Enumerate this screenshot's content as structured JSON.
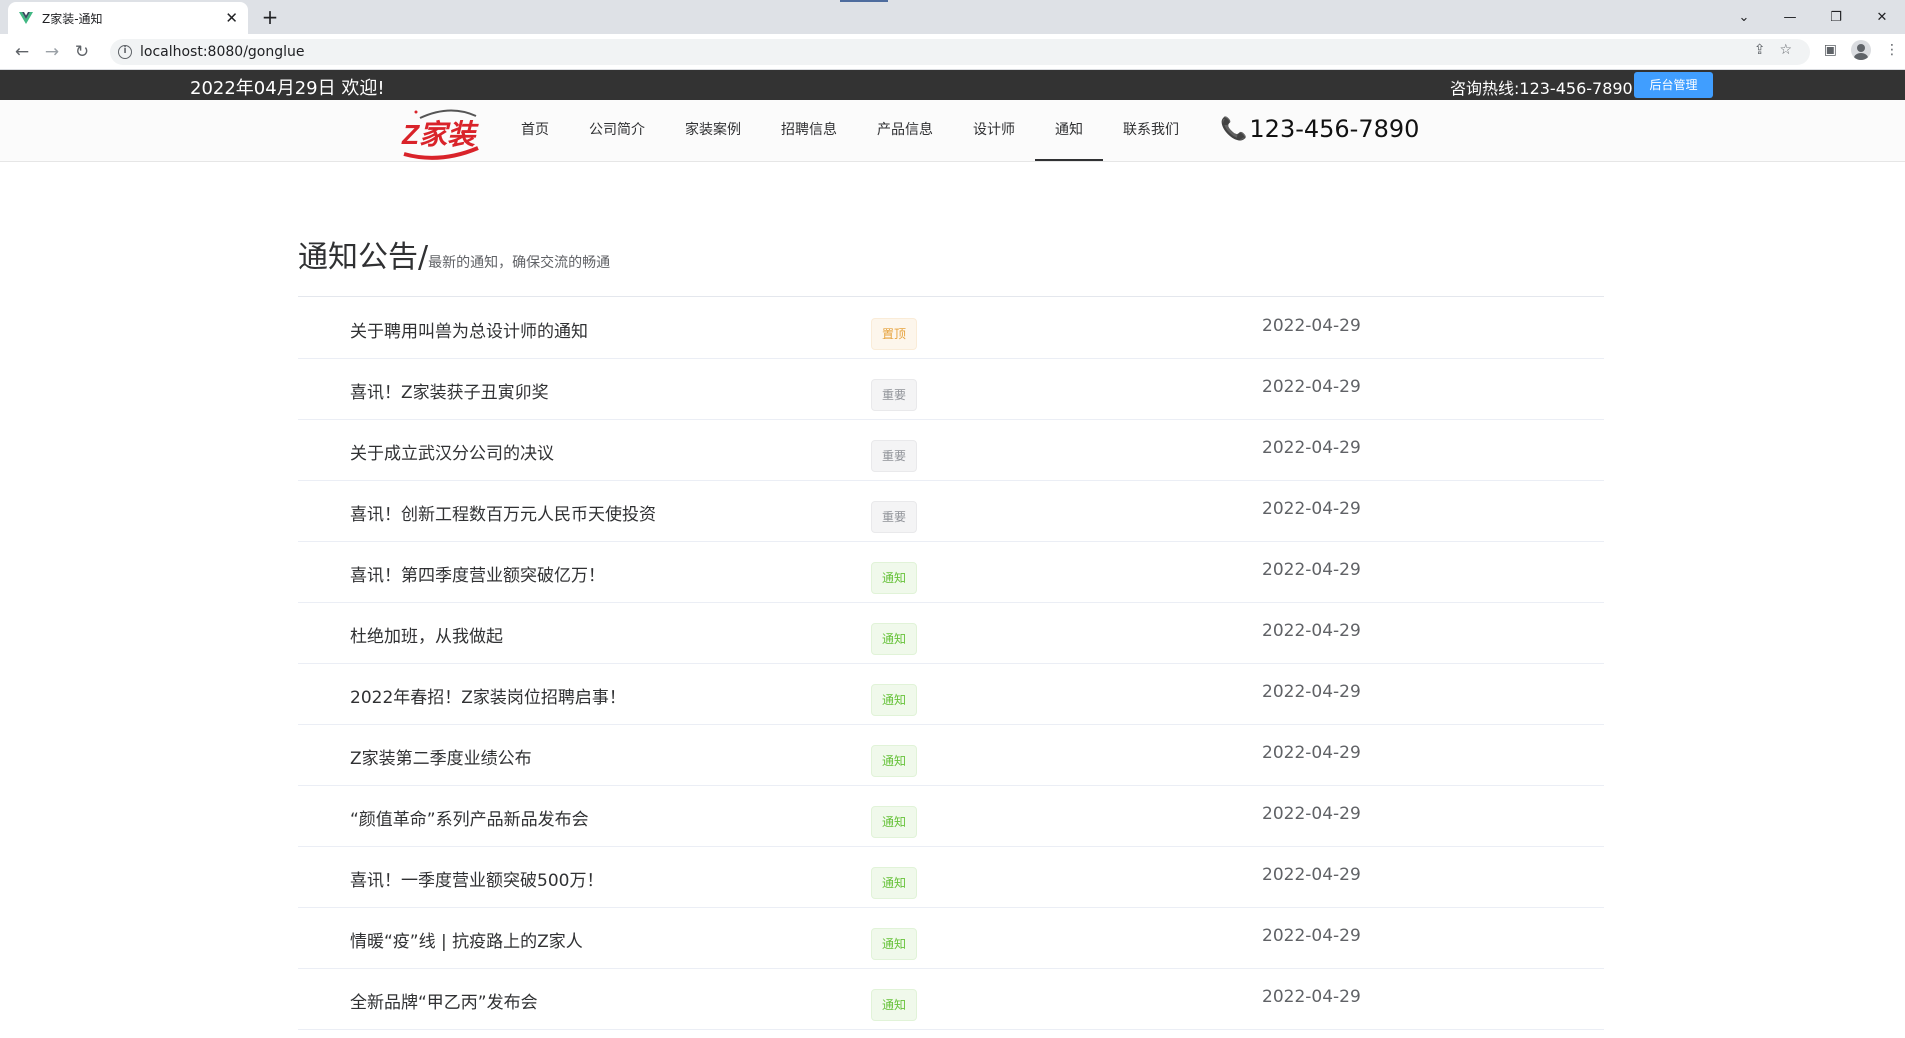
{
  "browser": {
    "tab_title": "Z家装-通知",
    "url": "localhost:8080/gonglue"
  },
  "topbar": {
    "date_text": "2022年04月29日 欢迎!",
    "hotline_text": "咨询热线:123-456-7890",
    "admin_button": "后台管理"
  },
  "logo": {
    "text": "Z家装"
  },
  "nav": {
    "items": [
      {
        "label": "首页"
      },
      {
        "label": "公司简介"
      },
      {
        "label": "家装案例"
      },
      {
        "label": "招聘信息"
      },
      {
        "label": "产品信息"
      },
      {
        "label": "设计师"
      },
      {
        "label": "通知",
        "active": true
      },
      {
        "label": "联系我们"
      }
    ],
    "phone": "123-456-7890"
  },
  "heading": {
    "main": "通知公告/",
    "sub": "最新的通知，确保交流的畅通"
  },
  "notices": [
    {
      "title": "关于聘用叫兽为总设计师的通知",
      "tag": "置顶",
      "tag_type": "warning",
      "date": "2022-04-29"
    },
    {
      "title": "喜讯！Z家装获子丑寅卯奖",
      "tag": "重要",
      "tag_type": "info",
      "date": "2022-04-29"
    },
    {
      "title": "关于成立武汉分公司的决议",
      "tag": "重要",
      "tag_type": "info",
      "date": "2022-04-29"
    },
    {
      "title": "喜讯！创新工程数百万元人民币天使投资",
      "tag": "重要",
      "tag_type": "info",
      "date": "2022-04-29"
    },
    {
      "title": "喜讯！第四季度营业额突破亿万！",
      "tag": "通知",
      "tag_type": "success",
      "date": "2022-04-29"
    },
    {
      "title": "杜绝加班，从我做起",
      "tag": "通知",
      "tag_type": "success",
      "date": "2022-04-29"
    },
    {
      "title": "2022年春招！Z家装岗位招聘启事！",
      "tag": "通知",
      "tag_type": "success",
      "date": "2022-04-29"
    },
    {
      "title": "Z家装第二季度业绩公布",
      "tag": "通知",
      "tag_type": "success",
      "date": "2022-04-29"
    },
    {
      "title": "“颜值革命”系列产品新品发布会",
      "tag": "通知",
      "tag_type": "success",
      "date": "2022-04-29"
    },
    {
      "title": "喜讯！一季度营业额突破500万！",
      "tag": "通知",
      "tag_type": "success",
      "date": "2022-04-29"
    },
    {
      "title": "情暖“疫”线 | 抗疫路上的Z家人",
      "tag": "通知",
      "tag_type": "success",
      "date": "2022-04-29"
    },
    {
      "title": "全新品牌“甲乙丙”发布会",
      "tag": "通知",
      "tag_type": "success",
      "date": "2022-04-29"
    }
  ],
  "colors": {
    "topbar_bg": "#333333",
    "admin_button_bg": "#409eff",
    "logo_red": "#d9232a",
    "tag_warning": "#e6a23c",
    "tag_info": "#909399",
    "tag_success": "#67c23a"
  }
}
